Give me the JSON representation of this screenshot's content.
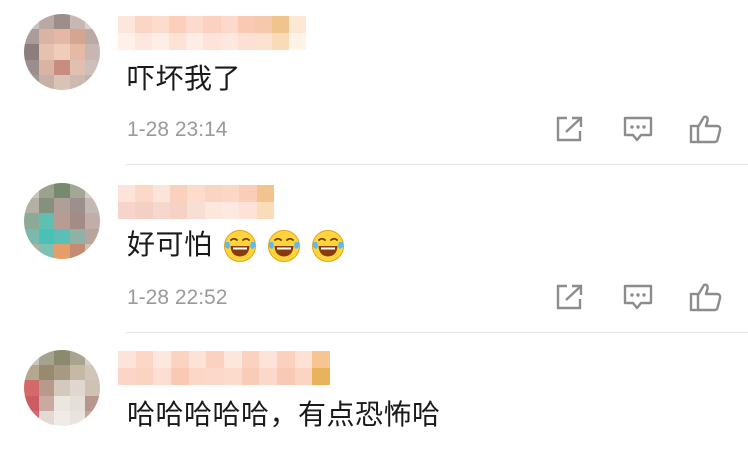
{
  "comments": [
    {
      "text": "吓坏我了",
      "timestamp": "1-28 23:14",
      "emojis": []
    },
    {
      "text": "好可怕",
      "timestamp": "1-28 22:52",
      "emojis": [
        "laughing-tears-emoji",
        "laughing-tears-emoji",
        "laughing-tears-emoji"
      ]
    },
    {
      "text": "哈哈哈哈哈，有点恐怖哈",
      "timestamp": "",
      "emojis": []
    }
  ],
  "actions": {
    "share_icon": "share-icon",
    "reply_icon": "reply-icon",
    "like_icon": "thumbs-up-icon"
  },
  "colors": {
    "text": "#1a1a1a",
    "timestamp": "#9a9a9a",
    "icon": "#8c8c8c",
    "divider": "#e6e6e6"
  }
}
